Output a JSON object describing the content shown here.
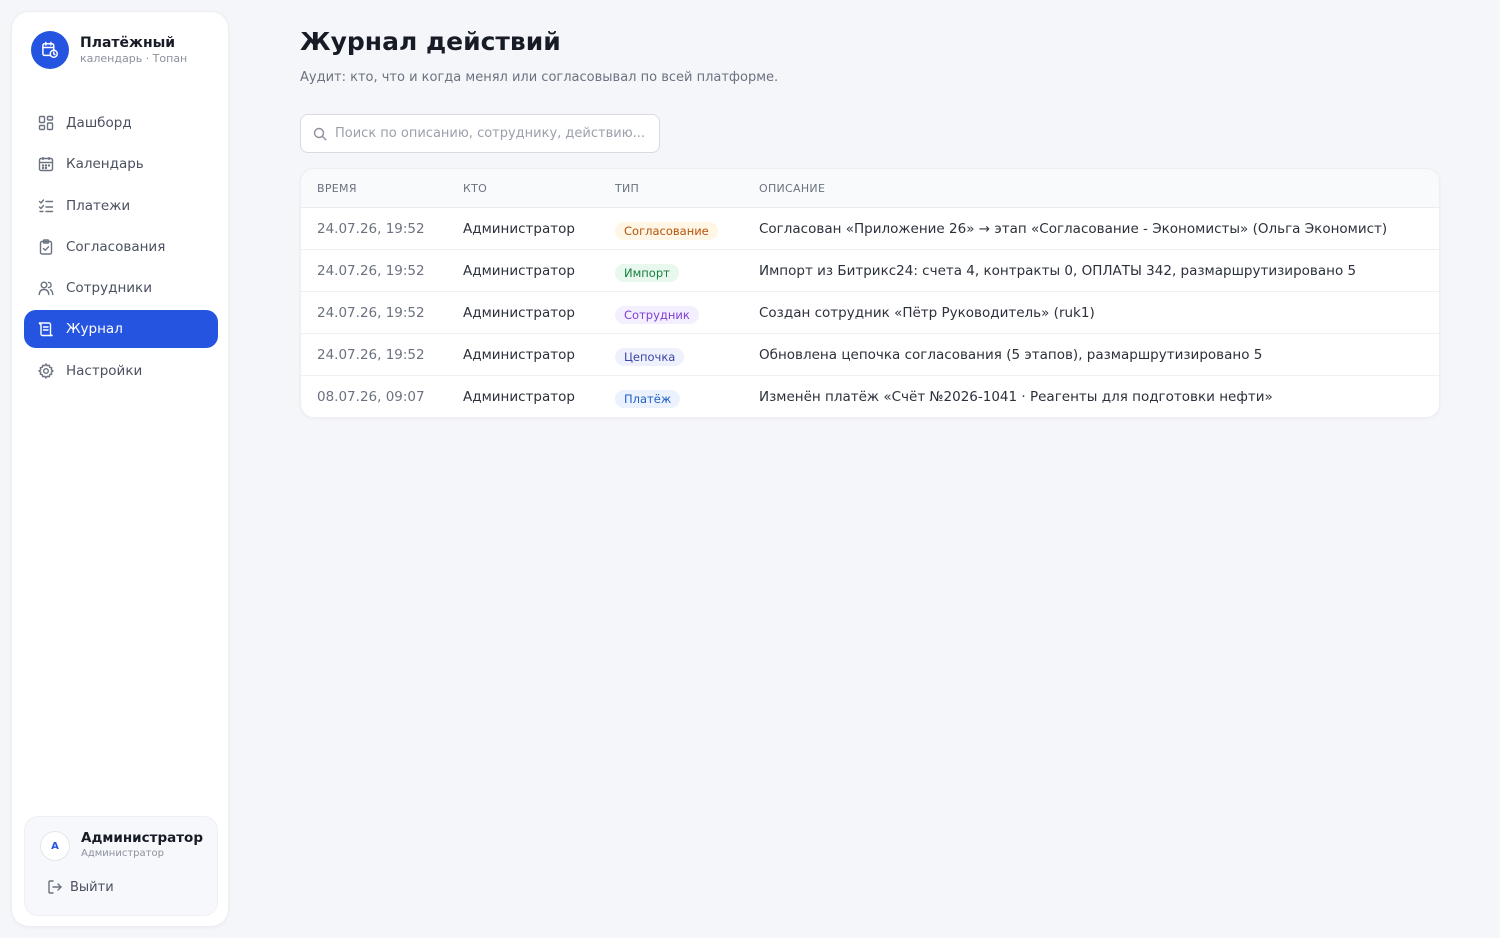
{
  "brand": {
    "title": "Платёжный",
    "subtitle": "календарь · Топан",
    "logo_icon": "calendar-clock-icon",
    "accent": "#2554e0"
  },
  "nav": {
    "items": [
      {
        "label": "Дашборд",
        "icon": "dashboard-grid-icon",
        "active": false
      },
      {
        "label": "Календарь",
        "icon": "calendar-icon",
        "active": false
      },
      {
        "label": "Платежи",
        "icon": "checklist-icon",
        "active": false
      },
      {
        "label": "Согласования",
        "icon": "clipboard-check-icon",
        "active": false
      },
      {
        "label": "Сотрудники",
        "icon": "users-icon",
        "active": false
      },
      {
        "label": "Журнал",
        "icon": "scroll-log-icon",
        "active": true
      },
      {
        "label": "Настройки",
        "icon": "gear-icon",
        "active": false
      }
    ]
  },
  "user": {
    "initial": "А",
    "name": "Администратор",
    "role": "Администратор",
    "logout_label": "Выйти"
  },
  "page": {
    "title": "Журнал действий",
    "subtitle": "Аудит: кто, что и когда менял или согласовывал по всей платформе."
  },
  "search": {
    "placeholder": "Поиск по описанию, сотруднику, действию...",
    "value": ""
  },
  "table": {
    "headers": {
      "time": "ВРЕМЯ",
      "who": "КТО",
      "type": "ТИП",
      "desc": "ОПИСАНИЕ"
    },
    "rows": [
      {
        "time": "24.07.26, 19:52",
        "who": "Администратор",
        "type": "Согласование",
        "type_bg": "#fff6e6",
        "type_color": "#b45309",
        "desc": "Согласован «Приложение 26» → этап «Согласование - Экономисты» (Ольга Экономист)"
      },
      {
        "time": "24.07.26, 19:52",
        "who": "Администратор",
        "type": "Импорт",
        "type_bg": "#e8f8ef",
        "type_color": "#15803d",
        "desc": "Импорт из Битрикс24: счета 4, контракты 0, ОПЛАТЫ 342, размаршрутизировано 5"
      },
      {
        "time": "24.07.26, 19:52",
        "who": "Администратор",
        "type": "Сотрудник",
        "type_bg": "#f3efff",
        "type_color": "#7e3fd6",
        "desc": "Создан сотрудник «Пётр Руководитель» (ruk1)"
      },
      {
        "time": "24.07.26, 19:52",
        "who": "Администратор",
        "type": "Цепочка",
        "type_bg": "#eef0fc",
        "type_color": "#3a46a8",
        "desc": "Обновлена цепочка согласования (5 этапов), размаршрутизировано 5"
      },
      {
        "time": "08.07.26, 09:07",
        "who": "Администратор",
        "type": "Платёж",
        "type_bg": "#ebf2fd",
        "type_color": "#1f5fc7",
        "desc": "Изменён платёж «Счёт №2026-1041 · Реагенты для подготовки нефти»"
      }
    ]
  }
}
